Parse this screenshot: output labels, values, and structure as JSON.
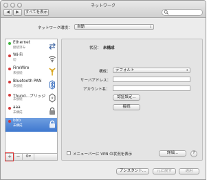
{
  "window": {
    "title": "ネットワーク"
  },
  "toolbar": {
    "back": "◀",
    "forward": "▶",
    "show_all": "すべてを表示"
  },
  "location": {
    "label": "ネットワーク環境：",
    "value": "自動"
  },
  "services": [
    {
      "name": "Ethernet",
      "status": "接続済み",
      "dot": "#3fb63f",
      "icon": "ethernet-icon"
    },
    {
      "name": "Wi-Fi",
      "status": "切",
      "dot": "#d43a3a",
      "icon": "wifi-icon"
    },
    {
      "name": "FireWire",
      "status": "未接続",
      "dot": "#d43a3a",
      "icon": "firewire-icon"
    },
    {
      "name": "Bluetooth PAN",
      "status": "未接続",
      "dot": "#d43a3a",
      "icon": "bluetooth-icon"
    },
    {
      "name": "Thund…ブリッジ",
      "status": "未接続",
      "dot": "#d43a3a",
      "icon": "thunderbolt-icon"
    },
    {
      "name": "aaa",
      "status": "未構成",
      "dot": "#d43a3a",
      "icon": "lock-icon"
    },
    {
      "name": "bbb",
      "status": "未構成",
      "dot": "#d43a3a",
      "icon": "lock-icon"
    }
  ],
  "list_bar": {
    "add": "+",
    "remove": "−",
    "gear": "⚙▾"
  },
  "detail": {
    "status_label": "状況：",
    "status_value": "未構成",
    "config_label": "構成：",
    "config_value": "デフォルト",
    "server_label": "サーバアドレス：",
    "account_label": "アカウント名：",
    "auth_button": "認証設定...",
    "connect_button": "接続"
  },
  "menu_bar_checkbox": {
    "label": "メニューバーに VPN の状況を表示"
  },
  "buttons": {
    "advanced": "詳細...",
    "help": "?",
    "assistant": "アシスタント...",
    "revert": "元に戻す",
    "apply": "適用"
  }
}
